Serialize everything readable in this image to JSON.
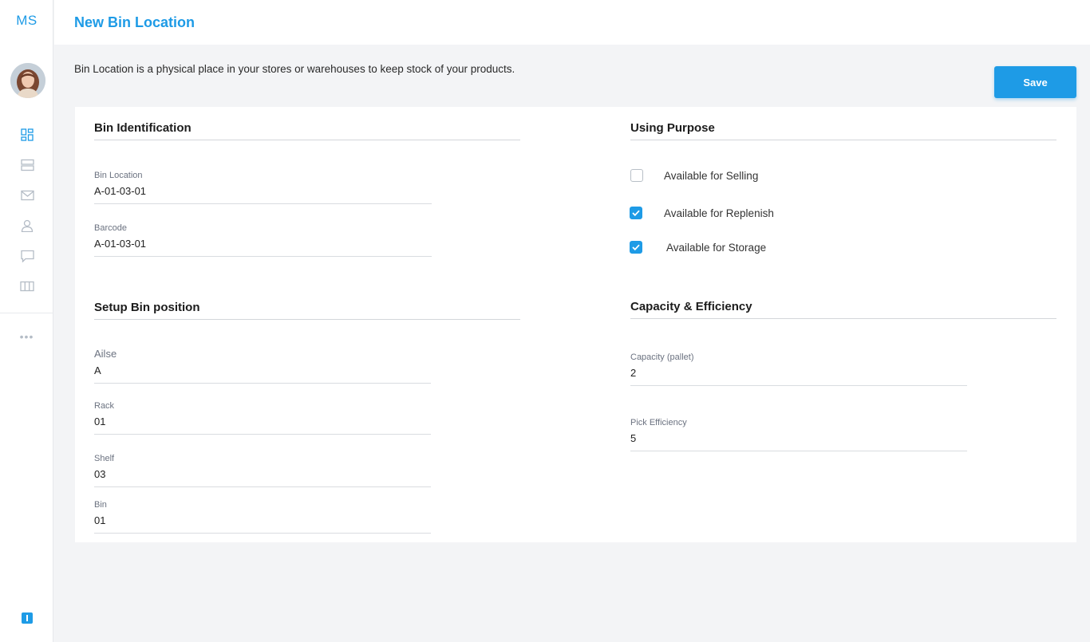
{
  "app": {
    "logo_text": "MS"
  },
  "page": {
    "title": "New Bin Location",
    "description": "Bin Location is a physical place in your stores or warehouses to keep stock of your products.",
    "save_label": "Save"
  },
  "sidebar": {
    "items": [
      {
        "icon": "dashboard-icon",
        "active": true
      },
      {
        "icon": "layers-icon",
        "active": false
      },
      {
        "icon": "mail-icon",
        "active": false
      },
      {
        "icon": "user-icon",
        "active": false
      },
      {
        "icon": "chat-icon",
        "active": false
      },
      {
        "icon": "columns-icon",
        "active": false
      }
    ],
    "more_label": "•••"
  },
  "bin_identification": {
    "title": "Bin Identification",
    "bin_location": {
      "label": "Bin Location",
      "value": "A-01-03-01"
    },
    "barcode": {
      "label": "Barcode",
      "value": "A-01-03-01"
    }
  },
  "using_purpose": {
    "title": "Using Purpose",
    "options": [
      {
        "label": "Available for Selling",
        "checked": false
      },
      {
        "label": "Available for Replenish",
        "checked": true
      },
      {
        "label": "Available for Storage",
        "checked": true
      }
    ]
  },
  "bin_position": {
    "title": "Setup Bin position",
    "aisle": {
      "label": "Ailse",
      "value": "A"
    },
    "rack": {
      "label": "Rack",
      "value": "01"
    },
    "shelf": {
      "label": "Shelf",
      "value": "03"
    },
    "bin": {
      "label": "Bin",
      "value": "01"
    }
  },
  "capacity": {
    "title": "Capacity & Efficiency",
    "capacity_pallet": {
      "label": "Capacity (pallet)",
      "value": "2"
    },
    "pick_efficiency": {
      "label": "Pick Efficiency",
      "value": "5"
    }
  },
  "colors": {
    "accent": "#1e9be6",
    "background": "#f3f4f6",
    "nav_icon": "#b4bcc6"
  }
}
